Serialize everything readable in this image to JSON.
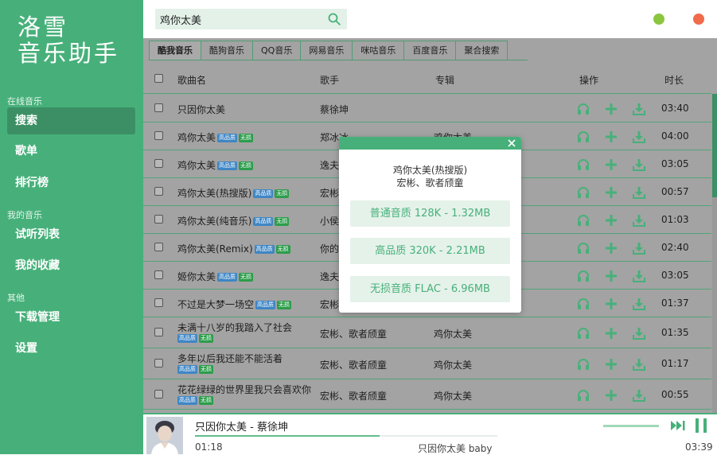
{
  "sidebar": {
    "logo_line1": "洛雪",
    "logo_line2": "音乐助手",
    "sections": [
      {
        "label": "在线音乐",
        "items": [
          {
            "label": "搜索",
            "active": true
          },
          {
            "label": "歌单"
          },
          {
            "label": "排行榜"
          }
        ]
      },
      {
        "label": "我的音乐",
        "items": [
          {
            "label": "试听列表"
          },
          {
            "label": "我的收藏"
          }
        ]
      },
      {
        "label": "其他",
        "items": [
          {
            "label": "下载管理"
          },
          {
            "label": "设置"
          }
        ]
      }
    ]
  },
  "header": {
    "search_value": "鸡你太美"
  },
  "tabs": [
    "酷我音乐",
    "酷狗音乐",
    "QQ音乐",
    "网易音乐",
    "咪咕音乐",
    "百度音乐",
    "聚合搜索"
  ],
  "table": {
    "headers": {
      "name": "歌曲名",
      "artist": "歌手",
      "album": "专辑",
      "ops": "操作",
      "duration": "时长"
    },
    "badges": {
      "hq": "高品质",
      "lossless": "无损"
    },
    "rows": [
      {
        "name": "只因你太美",
        "hq": false,
        "lossless": false,
        "artist": "蔡徐坤",
        "album": "",
        "duration": "03:40",
        "wrap": false
      },
      {
        "name": "鸡你太美",
        "hq": true,
        "lossless": true,
        "artist": "郑冰冰",
        "album": "鸡你太美",
        "duration": "04:00",
        "wrap": false
      },
      {
        "name": "鸡你太美",
        "hq": true,
        "lossless": true,
        "artist": "逸夫",
        "album": "",
        "duration": "03:05",
        "wrap": false
      },
      {
        "name": "鸡你太美(热搜版)",
        "hq": true,
        "lossless": true,
        "artist": "宏彬",
        "album": "",
        "duration": "00:57",
        "wrap": false
      },
      {
        "name": "鸡你太美(纯音乐)",
        "hq": true,
        "lossless": true,
        "artist": "小侯",
        "album": "",
        "duration": "01:03",
        "wrap": false
      },
      {
        "name": "鸡你太美(Remix)",
        "hq": true,
        "lossless": true,
        "artist": "你的",
        "album": "",
        "duration": "02:40",
        "wrap": false
      },
      {
        "name": "姬你太美",
        "hq": true,
        "lossless": true,
        "artist": "逸夫",
        "album": "",
        "duration": "03:05",
        "wrap": false
      },
      {
        "name": "不过是大梦一场空",
        "hq": true,
        "lossless": true,
        "artist": "宏彬",
        "album": "",
        "duration": "01:37",
        "wrap": false
      },
      {
        "name": "未满十八岁的我踏入了社会",
        "hq": true,
        "lossless": true,
        "artist": "宏彬、歌者颀童",
        "album": "鸡你太美",
        "duration": "01:35",
        "wrap": true
      },
      {
        "name": "多年以后我还能不能活着",
        "hq": true,
        "lossless": true,
        "artist": "宏彬、歌者颀童",
        "album": "鸡你太美",
        "duration": "01:17",
        "wrap": true
      },
      {
        "name": "花花绿绿的世界里我只会喜欢你",
        "hq": true,
        "lossless": true,
        "artist": "宏彬、歌者颀童",
        "album": "鸡你太美",
        "duration": "00:55",
        "wrap": true
      }
    ]
  },
  "modal": {
    "song": "鸡你太美(热搜版)",
    "artist": "宏彬、歌者颀童",
    "options": [
      "普通音质 128K - 1.32MB",
      "高品质 320K - 2.21MB",
      "无损音质 FLAC - 6.96MB"
    ]
  },
  "player": {
    "title": "只因你太美 - 蔡徐坤",
    "current_time": "01:18",
    "lyric": "只因你太美 baby",
    "total_time": "03:39",
    "progress": 0.61,
    "volume": 1.0
  },
  "colors": {
    "accent": "#47b07a",
    "accent_dark": "#3c8f64",
    "hq_badge": "#3f86c5",
    "lossless_badge": "#2d9d4c"
  }
}
